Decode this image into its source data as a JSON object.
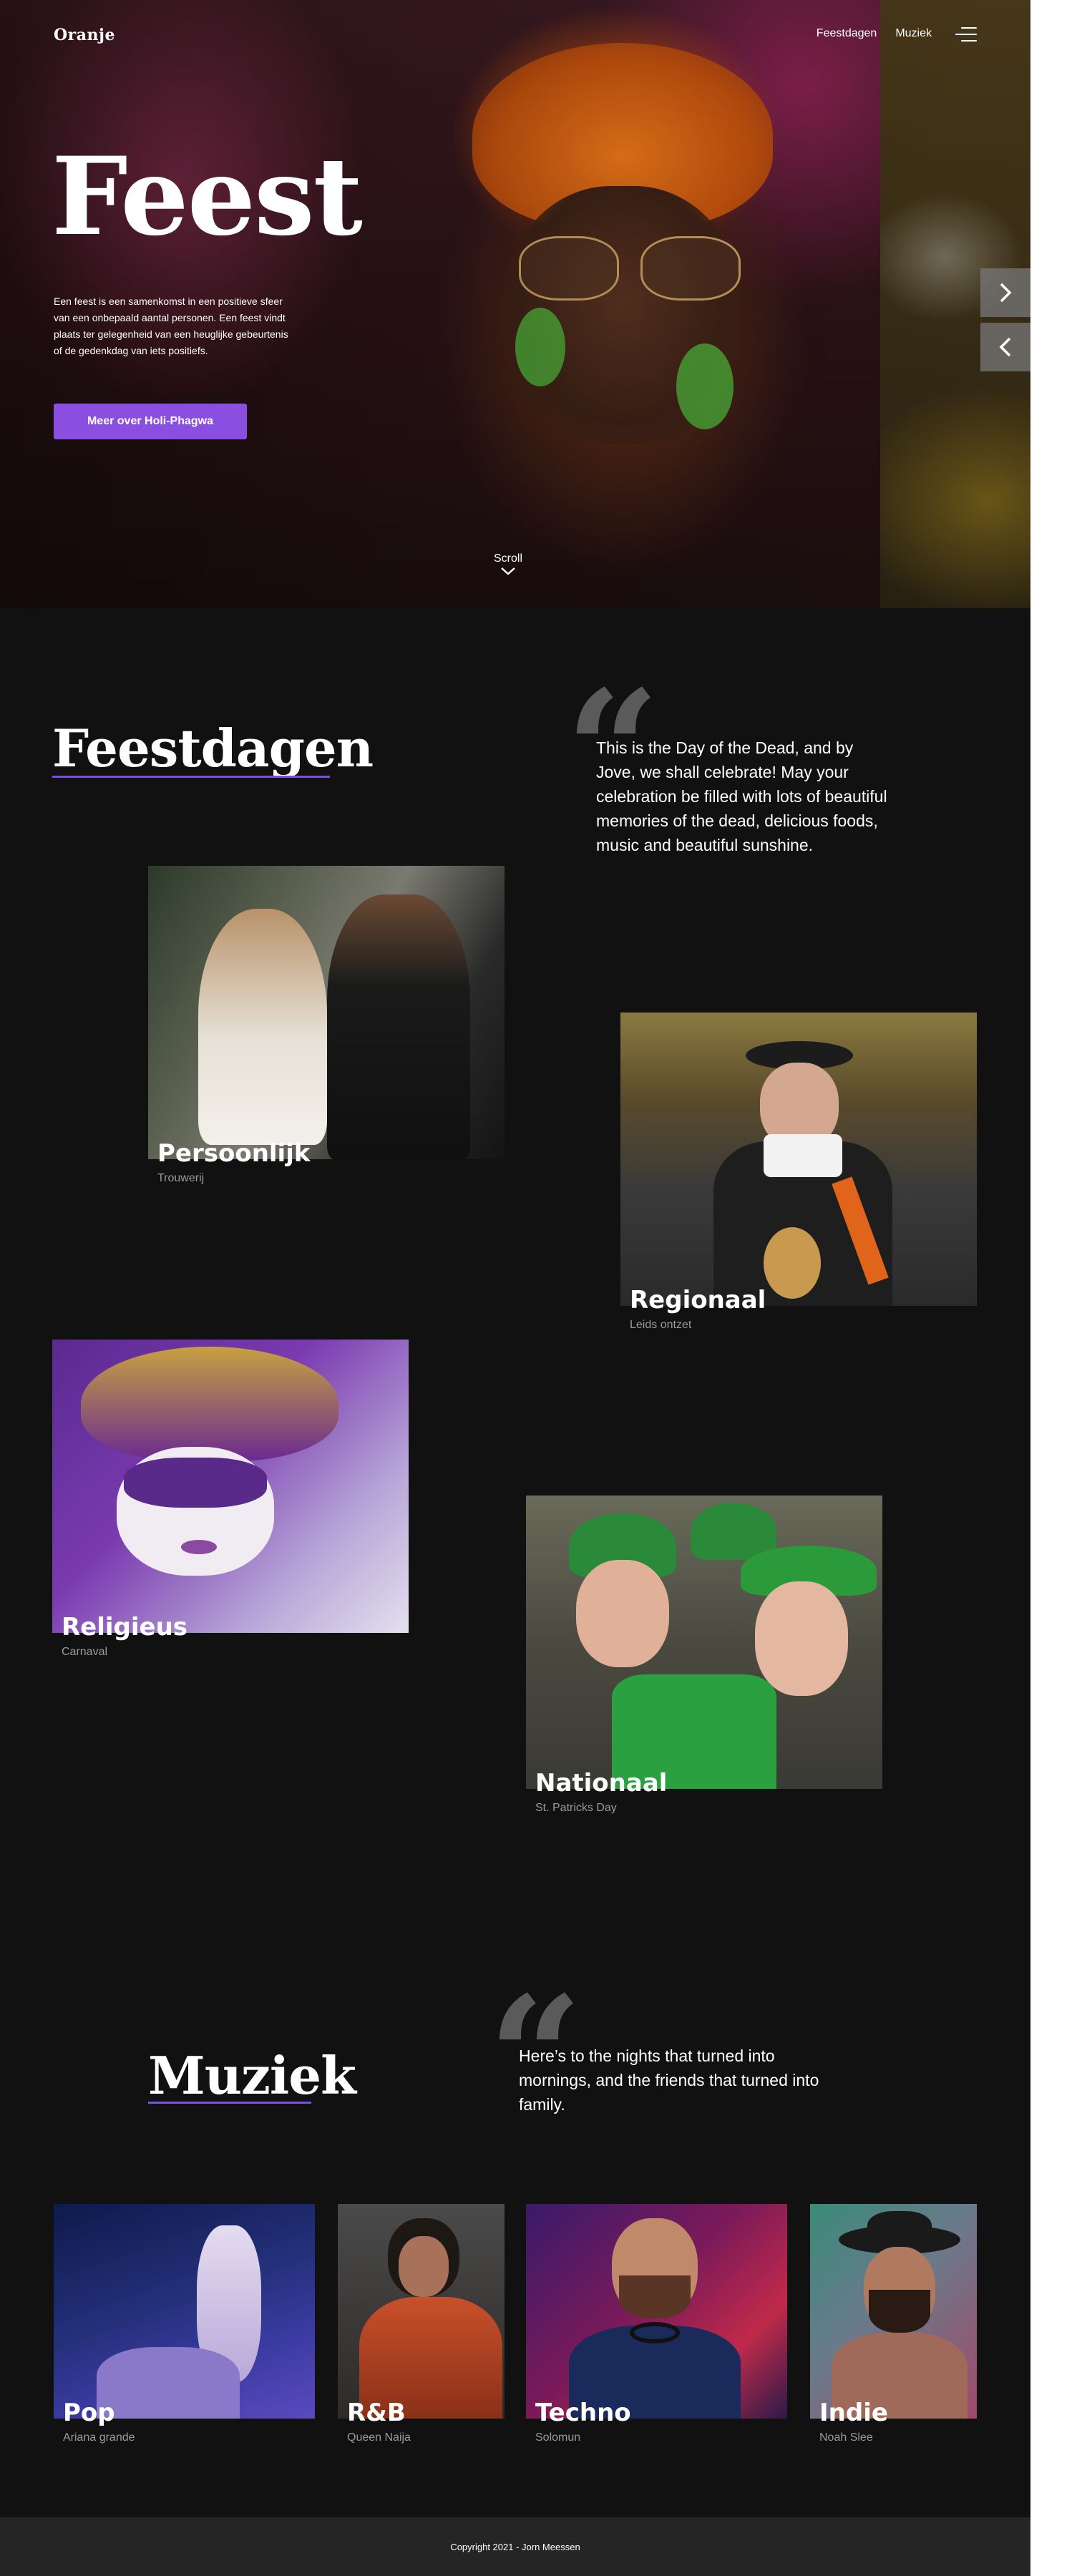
{
  "brand": {
    "logo": "Oranje",
    "accent": "#8a4fe0"
  },
  "nav": {
    "items": [
      "Feestdagen",
      "Muziek"
    ],
    "menu_icon": "hamburger-menu-icon"
  },
  "hero": {
    "title": "Feest",
    "description": "Een feest is een samenkomst in een positieve sfeer van een onbepaald aantal personen. Een feest vindt plaats ter gelegenheid van een heuglijke gebeurtenis of de gedenkdag van iets positiefs.",
    "button": "Meer over Holi-Phagwa",
    "scroll": "Scroll",
    "next_icon": "chevron-right-icon",
    "prev_icon": "chevron-left-icon"
  },
  "feestdagen": {
    "title": "Feestdagen",
    "quote": "This is the Day of the Dead, and by Jove, we shall celebrate! May your celebration be filled with lots of beautiful memories of the dead, delicious foods, music and beautiful sunshine.",
    "cards": [
      {
        "label": "Persoonlijk",
        "sub": "Trouwerij"
      },
      {
        "label": "Regionaal",
        "sub": "Leids ontzet"
      },
      {
        "label": "Religieus",
        "sub": "Carnaval"
      },
      {
        "label": "Nationaal",
        "sub": "St. Patricks Day"
      }
    ]
  },
  "muziek": {
    "title": "Muziek",
    "quote": "Here’s to the nights that turned into mornings, and the friends that turned into family.",
    "cards": [
      {
        "label": "Pop",
        "sub": "Ariana grande"
      },
      {
        "label": "R&B",
        "sub": "Queen Naija"
      },
      {
        "label": "Techno",
        "sub": "Solomun"
      },
      {
        "label": "Indie",
        "sub": "Noah Slee"
      }
    ]
  },
  "footer": {
    "copyright": "Copyright 2021 - Jorn Meessen"
  }
}
